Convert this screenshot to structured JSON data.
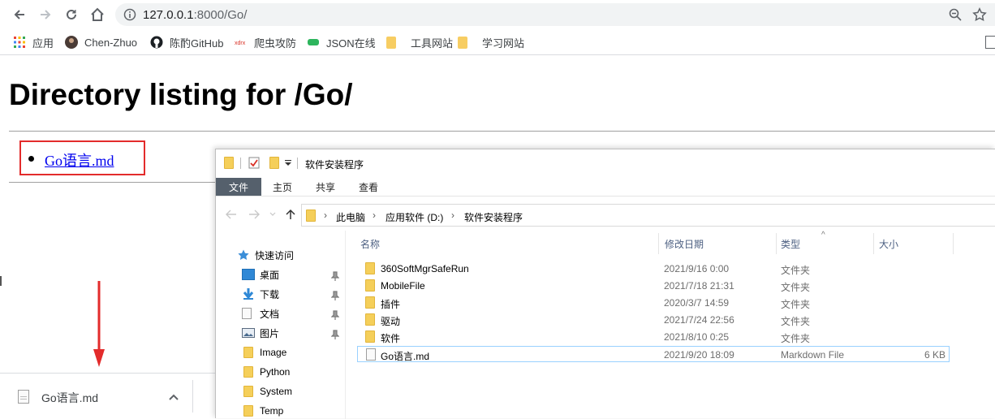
{
  "browser": {
    "url_host": "127.0.0.1",
    "url_path": ":8000/Go/",
    "bookmarks": [
      {
        "label": "应用",
        "icon": "apps-grid-icon"
      },
      {
        "label": "Chen-Zhuo",
        "icon": "avatar-icon"
      },
      {
        "label": "陈酌GitHub",
        "icon": "github-icon"
      },
      {
        "label": "爬虫攻防",
        "icon": "site-icon"
      },
      {
        "label": "JSON在线",
        "icon": "json-icon"
      },
      {
        "label": "工具网站",
        "icon": "folder-icon"
      },
      {
        "label": "学习网站",
        "icon": "folder-icon"
      }
    ]
  },
  "page": {
    "title": "Directory listing for /Go/",
    "items": [
      {
        "label": "Go语言.md"
      }
    ]
  },
  "download_shelf": {
    "file_name": "Go语言.md"
  },
  "explorer": {
    "window_title": "软件安装程序",
    "ribbon_tabs": [
      "文件",
      "主页",
      "共享",
      "查看"
    ],
    "breadcrumb": [
      "此电脑",
      "应用软件 (D:)",
      "软件安装程序"
    ],
    "nav": {
      "quick_access": "快速访问",
      "items": [
        {
          "label": "桌面",
          "pinned": true
        },
        {
          "label": "下载",
          "pinned": true
        },
        {
          "label": "文档",
          "pinned": true
        },
        {
          "label": "图片",
          "pinned": true
        },
        {
          "label": "Image",
          "pinned": false
        },
        {
          "label": "Python",
          "pinned": false
        },
        {
          "label": "System",
          "pinned": false
        },
        {
          "label": "Temp",
          "pinned": false
        }
      ]
    },
    "columns": [
      "名称",
      "修改日期",
      "类型",
      "大小"
    ],
    "files": [
      {
        "name": "360SoftMgrSafeRun",
        "modified": "2021/9/16 0:00",
        "type": "文件夹",
        "size": "",
        "kind": "folder"
      },
      {
        "name": "MobileFile",
        "modified": "2021/7/18 21:31",
        "type": "文件夹",
        "size": "",
        "kind": "folder"
      },
      {
        "name": "插件",
        "modified": "2020/3/7 14:59",
        "type": "文件夹",
        "size": "",
        "kind": "folder"
      },
      {
        "name": "驱动",
        "modified": "2021/7/24 22:56",
        "type": "文件夹",
        "size": "",
        "kind": "folder"
      },
      {
        "name": "软件",
        "modified": "2021/8/10 0:25",
        "type": "文件夹",
        "size": "",
        "kind": "folder"
      },
      {
        "name": "Go语言.md",
        "modified": "2021/9/20 18:09",
        "type": "Markdown File",
        "size": "6 KB",
        "kind": "file"
      }
    ]
  },
  "colors": {
    "annotation_red": "#e32b2b",
    "link_blue": "#0000ee",
    "folder_yellow": "#f5cf5a",
    "selection_border": "#99d1ff"
  }
}
